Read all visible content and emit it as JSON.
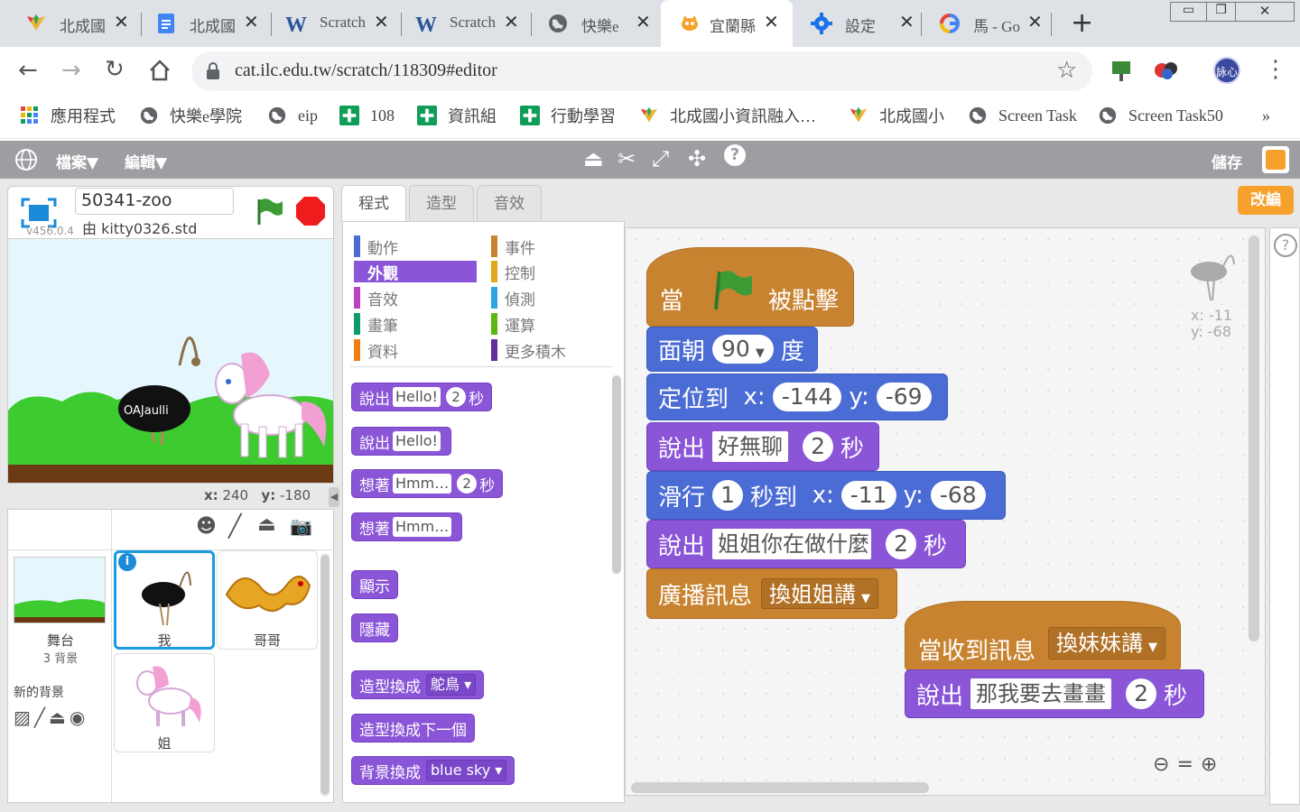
{
  "browser": {
    "tabs": [
      {
        "title": "北成國",
        "icon": "school-logo-icon"
      },
      {
        "title": "北成國",
        "icon": "docs-icon"
      },
      {
        "title": "Scratch",
        "icon": "word-icon"
      },
      {
        "title": "Scratch",
        "icon": "word-icon"
      },
      {
        "title": "快樂e",
        "icon": "globe-icon"
      },
      {
        "title": "宜蘭縣",
        "icon": "scratch-cat-icon"
      },
      {
        "title": "設定",
        "icon": "gear-icon"
      },
      {
        "title": "馬 - Go",
        "icon": "google-icon"
      }
    ],
    "url": "cat.ilc.edu.tw/scratch/118309#editor",
    "profile": "詠心",
    "bookmarks": [
      {
        "label": "應用程式",
        "icon": "apps-grid-icon"
      },
      {
        "label": "快樂e學院",
        "icon": "globe-icon"
      },
      {
        "label": "eip",
        "icon": "globe-icon"
      },
      {
        "label": "108",
        "icon": "green-plus-icon"
      },
      {
        "label": "資訊組",
        "icon": "green-plus-icon"
      },
      {
        "label": "行動學習",
        "icon": "green-plus-icon"
      },
      {
        "label": "北成國小資訊融入…",
        "icon": "school-logo-icon"
      },
      {
        "label": "北成國小",
        "icon": "school-logo-icon"
      },
      {
        "label": "Screen Task",
        "icon": "globe-icon"
      },
      {
        "label": "Screen Task50",
        "icon": "globe-icon"
      }
    ],
    "more": "»"
  },
  "scratch": {
    "menu": {
      "file": "檔案▼",
      "edit": "編輯▼",
      "save": "儲存",
      "remix": "改編"
    },
    "project": {
      "title": "50341-zoo",
      "by": "由 kitty0326.std",
      "version": "v456.0.4"
    },
    "stage_coords": {
      "x_label": "x:",
      "x": "240",
      "y_label": "y:",
      "y": "-180"
    },
    "stage_sprite_text": "OAJaulli",
    "tabs": [
      "程式",
      "造型",
      "音效"
    ],
    "categories_left": [
      {
        "label": "動作",
        "color": "#4a6cd4"
      },
      {
        "label": "外觀",
        "color": "#8a55d7",
        "selected": true
      },
      {
        "label": "音效",
        "color": "#bb42c3"
      },
      {
        "label": "畫筆",
        "color": "#0e9a6c"
      },
      {
        "label": "資料",
        "color": "#ee7d16"
      }
    ],
    "categories_right": [
      {
        "label": "事件",
        "color": "#c88330"
      },
      {
        "label": "控制",
        "color": "#e1a91a"
      },
      {
        "label": "偵測",
        "color": "#2ca5e2"
      },
      {
        "label": "運算",
        "color": "#5cb712"
      },
      {
        "label": "更多積木",
        "color": "#632d99"
      }
    ],
    "palette": {
      "say_for": {
        "label": "說出",
        "text": "Hello!",
        "num": "2",
        "unit": "秒"
      },
      "say": {
        "label": "說出",
        "text": "Hello!"
      },
      "think_for": {
        "label": "想著",
        "text": "Hmm…",
        "num": "2",
        "unit": "秒"
      },
      "think": {
        "label": "想著",
        "text": "Hmm…"
      },
      "show": "顯示",
      "hide": "隱藏",
      "switch_costume": {
        "label": "造型換成",
        "value": "鴕鳥"
      },
      "next_costume": "造型換成下一個",
      "switch_backdrop": {
        "label": "背景換成",
        "value": "blue sky"
      }
    },
    "script1": {
      "hat": {
        "pre": "當",
        "post": "被點擊"
      },
      "point": {
        "label": "面朝",
        "value": "90",
        "unit": "度"
      },
      "goto": {
        "label": "定位到",
        "x_label": "x:",
        "x": "-144",
        "y_label": "y:",
        "y": "-69"
      },
      "say1": {
        "label": "說出",
        "text": "好無聊",
        "num": "2",
        "unit": "秒"
      },
      "glide": {
        "label": "滑行",
        "num": "1",
        "mid": "秒到",
        "x_label": "x:",
        "x": "-11",
        "y_label": "y:",
        "y": "-68"
      },
      "say2": {
        "label": "說出",
        "text": "姐姐你在做什麼",
        "num": "2",
        "unit": "秒"
      },
      "broadcast": {
        "label": "廣播訊息",
        "value": "換姐姐講"
      }
    },
    "script2": {
      "hat": {
        "label": "當收到訊息",
        "value": "換妹妹講"
      },
      "say": {
        "label": "說出",
        "text": "那我要去畫畫",
        "num": "2",
        "unit": "秒"
      }
    },
    "sprite_info": {
      "x": "x: -11",
      "y": "y: -68"
    },
    "sprites_panel": {
      "stage_label": "舞台",
      "stage_backdrops": "3 背景",
      "new_backdrop": "新的背景",
      "sprites": [
        {
          "name": "我",
          "selected": true
        },
        {
          "name": "哥哥"
        },
        {
          "name": "姐"
        }
      ]
    },
    "colors": {
      "motion": "#4a6cd4",
      "looks": "#8a55d7",
      "events": "#c88330",
      "accent": "#f7a12d"
    }
  }
}
